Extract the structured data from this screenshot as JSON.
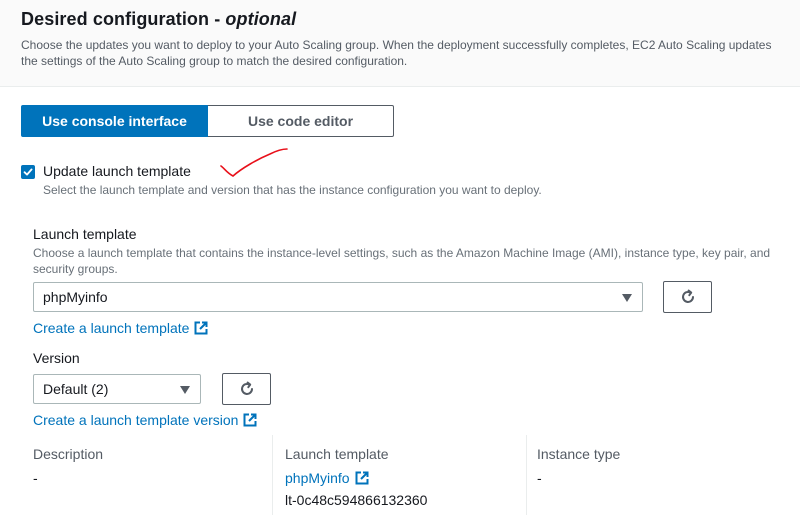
{
  "header": {
    "title": "Desired configuration - ",
    "title_optional": "optional",
    "description": "Choose the updates you want to deploy to your Auto Scaling group. When the deployment successfully completes, EC2 Auto Scaling updates the settings of the Auto Scaling group to match the desired configuration."
  },
  "mode_toggle": {
    "console_label": "Use console interface",
    "code_label": "Use code editor",
    "selected": "Use console interface"
  },
  "update_template": {
    "checked": true,
    "label": "Update launch template",
    "description": "Select the launch template and version that has the instance configuration you want to deploy."
  },
  "launch_template": {
    "label": "Launch template",
    "description": "Choose a launch template that contains the instance-level settings, such as the Amazon Machine Image (AMI), instance type, key pair, and security groups.",
    "selected": "phpMyinfo",
    "create_link": "Create a launch template"
  },
  "version": {
    "label": "Version",
    "selected": "Default (2)",
    "create_link": "Create a launch template version"
  },
  "details": {
    "description_label": "Description",
    "description_value": "-",
    "template_label": "Launch template",
    "template_link": "phpMyinfo",
    "template_id": "lt-0c48c594866132360",
    "instance_type_label": "Instance type",
    "instance_type_value": "-"
  },
  "colors": {
    "primary": "#0073bb",
    "annotation": "#e8101a",
    "text": "#16191f",
    "secondary_text": "#687078"
  },
  "icons": {
    "checkbox": "check-icon",
    "dropdown": "caret-down-icon",
    "refresh": "refresh-icon",
    "external": "external-link-icon"
  }
}
